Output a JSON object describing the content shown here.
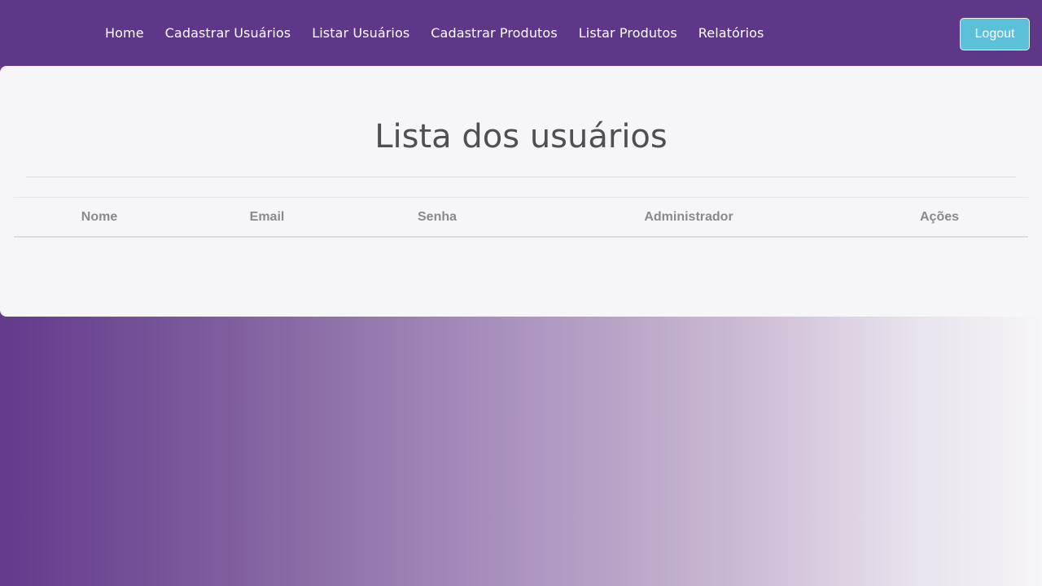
{
  "navbar": {
    "links": [
      {
        "label": "Home"
      },
      {
        "label": "Cadastrar Usuários"
      },
      {
        "label": "Listar Usuários"
      },
      {
        "label": "Cadastrar Produtos"
      },
      {
        "label": "Listar Produtos"
      },
      {
        "label": "Relatórios"
      }
    ],
    "logout_label": "Logout"
  },
  "main": {
    "title": "Lista dos usuários",
    "table": {
      "columns": [
        "Nome",
        "Email",
        "Senha",
        "Administrador",
        "Ações"
      ],
      "rows": []
    }
  },
  "colors": {
    "navbar_bg": "#5f3788",
    "logout_bg": "#5bc0d8",
    "card_bg": "#f6f6f8",
    "title_text": "#505052",
    "header_text": "#8a8a8c"
  }
}
